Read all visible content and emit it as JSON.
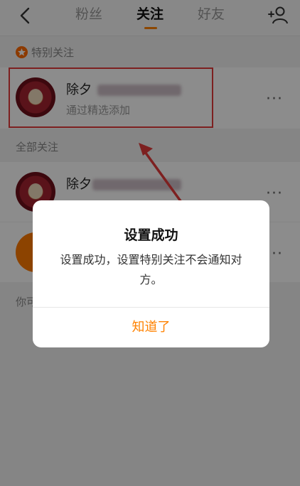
{
  "header": {
    "tabs": [
      {
        "label": "粉丝"
      },
      {
        "label": "关注"
      },
      {
        "label": "好友"
      }
    ],
    "active_tab": "关注"
  },
  "sections": {
    "special": {
      "label": "特别关注"
    },
    "all": {
      "label": "全部关注"
    },
    "maybe": {
      "label": "你可"
    }
  },
  "special_list": [
    {
      "name": "除夕",
      "subtitle": "通过精选添加"
    }
  ],
  "all_list": [
    {
      "name": "除夕"
    }
  ],
  "dialog": {
    "title": "设置成功",
    "message": "设置成功，设置特别关注不会通知对方。",
    "button": "知道了"
  },
  "more_label": "···",
  "colors": {
    "accent": "#ff8200",
    "highlight": "#e33b3b"
  }
}
